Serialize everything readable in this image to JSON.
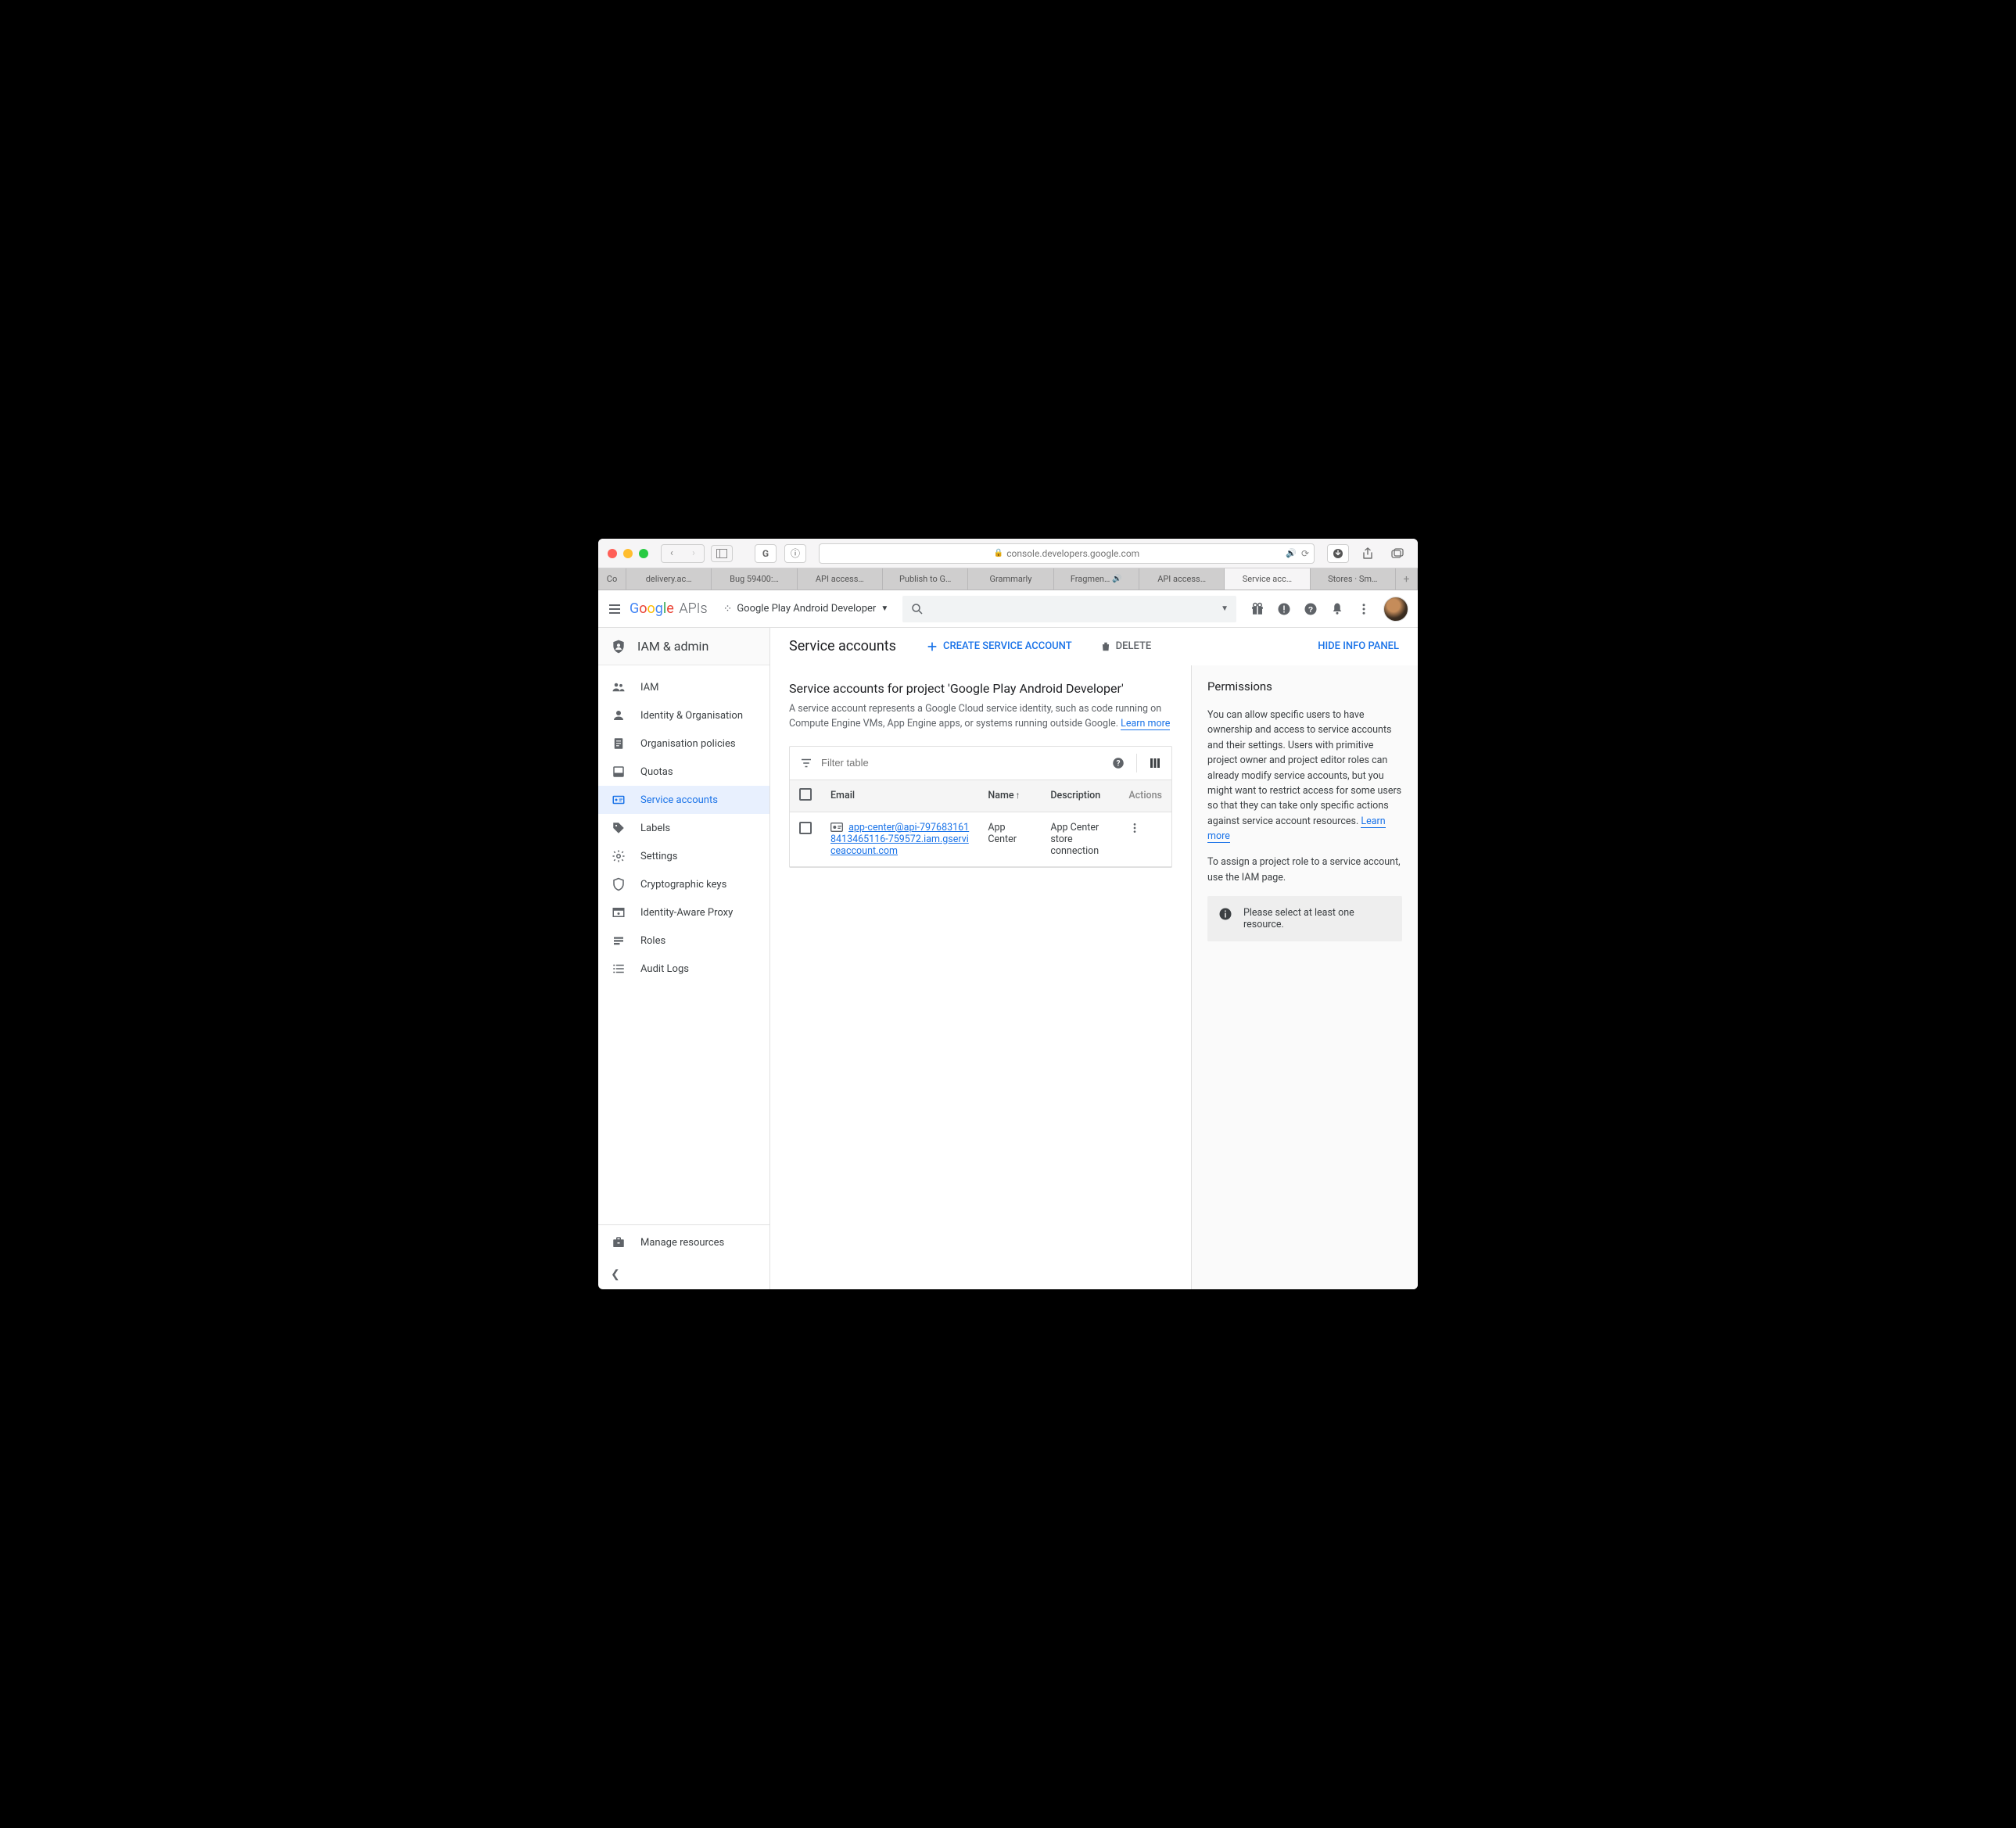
{
  "browser": {
    "url": "console.developers.google.com",
    "tabs": [
      {
        "label": "Co"
      },
      {
        "label": "delivery.ac…"
      },
      {
        "label": "Bug 59400:…"
      },
      {
        "label": "API access…"
      },
      {
        "label": "Publish to G…"
      },
      {
        "label": "Grammarly"
      },
      {
        "label": "Fragmen…",
        "sound": true
      },
      {
        "label": "API access…"
      },
      {
        "label": "Service acc…",
        "active": true
      },
      {
        "label": "Stores · Sm…"
      }
    ]
  },
  "header": {
    "logo_apis": "APIs",
    "project": "Google Play Android Developer"
  },
  "sidebar": {
    "section": "IAM & admin",
    "items": [
      {
        "label": "IAM"
      },
      {
        "label": "Identity & Organisation"
      },
      {
        "label": "Organisation policies"
      },
      {
        "label": "Quotas"
      },
      {
        "label": "Service accounts",
        "active": true
      },
      {
        "label": "Labels"
      },
      {
        "label": "Settings"
      },
      {
        "label": "Cryptographic keys"
      },
      {
        "label": "Identity-Aware Proxy"
      },
      {
        "label": "Roles"
      },
      {
        "label": "Audit Logs"
      }
    ],
    "footer": "Manage resources"
  },
  "main": {
    "title": "Service accounts",
    "create_btn": "CREATE SERVICE ACCOUNT",
    "delete_btn": "DELETE",
    "hide_panel": "HIDE INFO PANEL",
    "subtitle": "Service accounts for project 'Google Play Android Developer'",
    "description": "A service account represents a Google Cloud service identity, such as code running on Compute Engine VMs, App Engine apps, or systems running outside Google. ",
    "learn_more": "Learn more",
    "filter_placeholder": "Filter table",
    "columns": {
      "email": "Email",
      "name": "Name",
      "description": "Description",
      "actions": "Actions"
    },
    "rows": [
      {
        "email": "app-center@api-7976831618413465116-759572.iam.gserviceaccount.com",
        "name": "App Center",
        "description": "App Center store connection"
      }
    ]
  },
  "panel": {
    "title": "Permissions",
    "p1": "You can allow specific users to have ownership and access to service accounts and their settings. Users with primitive project owner and project editor roles can already modify service accounts, but you might want to restrict access for some users so that they can take only specific actions against service account resources. ",
    "learn_more": "Learn more",
    "p2": "To assign a project role to a service account, use the IAM page.",
    "notice": "Please select at least one resource."
  }
}
